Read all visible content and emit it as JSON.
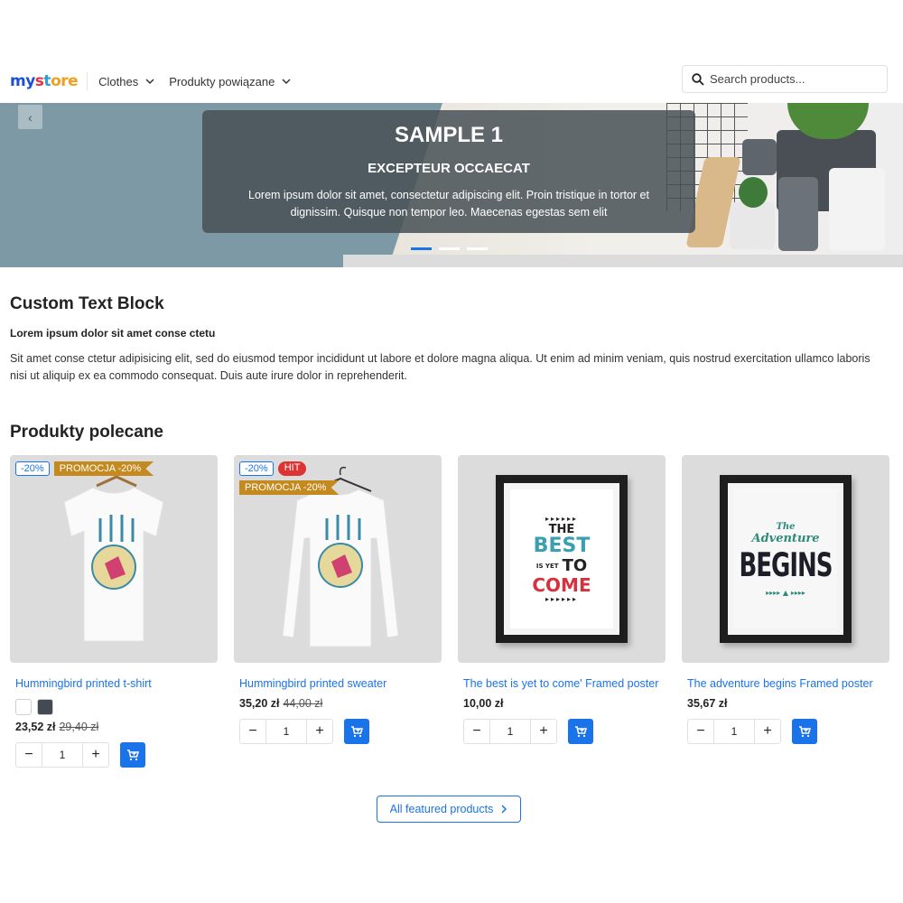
{
  "header": {
    "logo_parts": [
      "my",
      " ",
      "s",
      "t",
      "ore"
    ],
    "nav": [
      {
        "label": "Clothes"
      },
      {
        "label": "Produkty powiązane"
      }
    ],
    "search_placeholder": "Search products..."
  },
  "hero": {
    "title": "SAMPLE 1",
    "subtitle": "EXCEPTEUR OCCAECAT",
    "text": "Lorem ipsum dolor sit amet, consectetur adipiscing elit. Proin tristique in tortor et dignissim. Quisque non tempor leo. Maecenas egestas sem elit",
    "prev_icon": "‹",
    "slides_count": 3,
    "active_slide": 1
  },
  "custom_text": {
    "title": "Custom Text Block",
    "lead": "Lorem ipsum dolor sit amet conse ctetu",
    "paragraph": "Sit amet conse ctetur adipisicing elit, sed do eiusmod tempor incididunt ut labore et dolore magna aliqua. Ut enim ad minim veniam, quis nostrud exercitation ullamco laboris nisi ut aliquip ex ea commodo consequat. Duis aute irure dolor in reprehenderit."
  },
  "featured": {
    "title": "Produkty polecane",
    "all_button": "All featured products",
    "products": [
      {
        "name": "Hummingbird printed t-shirt",
        "badge_discount": "-20%",
        "badge_promo": "PROMOCJA -20%",
        "price": "23,52 zł",
        "old_price": "29,40 zł",
        "swatches": [
          "#ffffff",
          "#434a54"
        ],
        "qty": "1"
      },
      {
        "name": "Hummingbird printed sweater",
        "badge_discount": "-20%",
        "badge_hit": "HIT",
        "badge_promo": "PROMOCJA -20%",
        "price": "35,20 zł",
        "old_price": "44,00 zł",
        "qty": "1"
      },
      {
        "name": "The best is yet to come' Framed poster",
        "price": "10,00 zł",
        "qty": "1",
        "poster_lines": [
          "THE",
          "BEST",
          "IS YET",
          "TO",
          "COME"
        ]
      },
      {
        "name": "The adventure begins Framed poster",
        "price": "35,67 zł",
        "qty": "1",
        "poster_lines": [
          "The",
          "Adventure",
          "BEGINS"
        ]
      }
    ]
  },
  "colors": {
    "accent": "#1a73e8",
    "promo": "#c58a1f",
    "hit": "#dd3333"
  }
}
